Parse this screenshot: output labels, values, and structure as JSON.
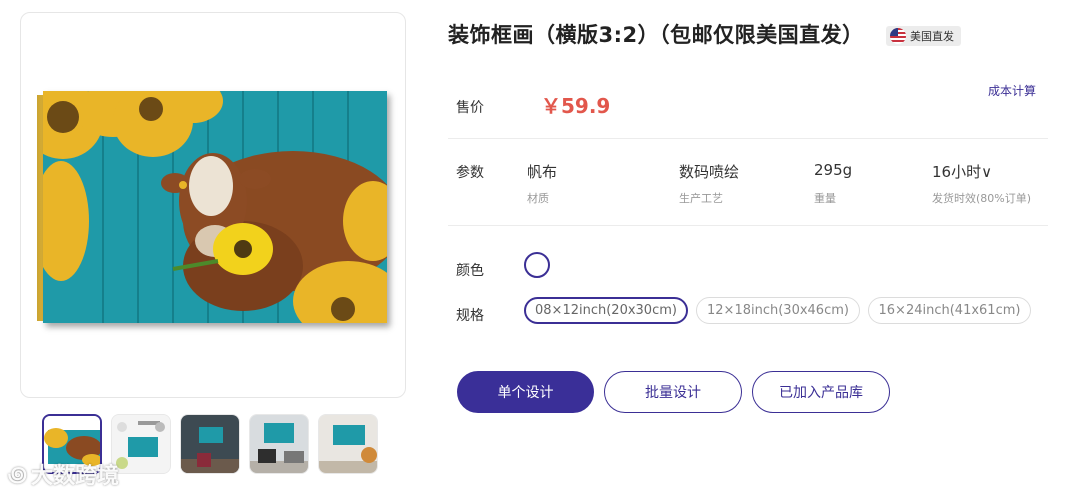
{
  "product": {
    "title": "装饰框画（横版3:2）（包邮仅限美国直发）",
    "ship_badge": "美国直发",
    "flag_icon": "us-flag-icon"
  },
  "price": {
    "label": "售价",
    "value": "￥59.9",
    "cost_link": "成本计算"
  },
  "params": {
    "label": "参数",
    "items": [
      {
        "value": "帆布",
        "caption": "材质"
      },
      {
        "value": "数码喷绘",
        "caption": "生产工艺"
      },
      {
        "value": "295g",
        "caption": "重量"
      },
      {
        "value": "16小时∨",
        "caption": "发货时效(80%订单)"
      }
    ]
  },
  "color": {
    "label": "颜色",
    "swatch": "#ffffff"
  },
  "size": {
    "label": "规格",
    "options": [
      "08×12inch(20x30cm)",
      "12×18inch(30x46cm)",
      "16×24inch(41x61cm)"
    ],
    "selected_index": 0
  },
  "actions": {
    "single_design": "单个设计",
    "batch_design": "批量设计",
    "added_to_library": "已加入产品库"
  },
  "gallery": {
    "thumbnail_count": 5,
    "active_index": 0
  },
  "watermark": {
    "text": "大数跨境"
  },
  "colors": {
    "accent": "#3b2f95",
    "price": "#e2574c",
    "divider": "#ececec"
  }
}
